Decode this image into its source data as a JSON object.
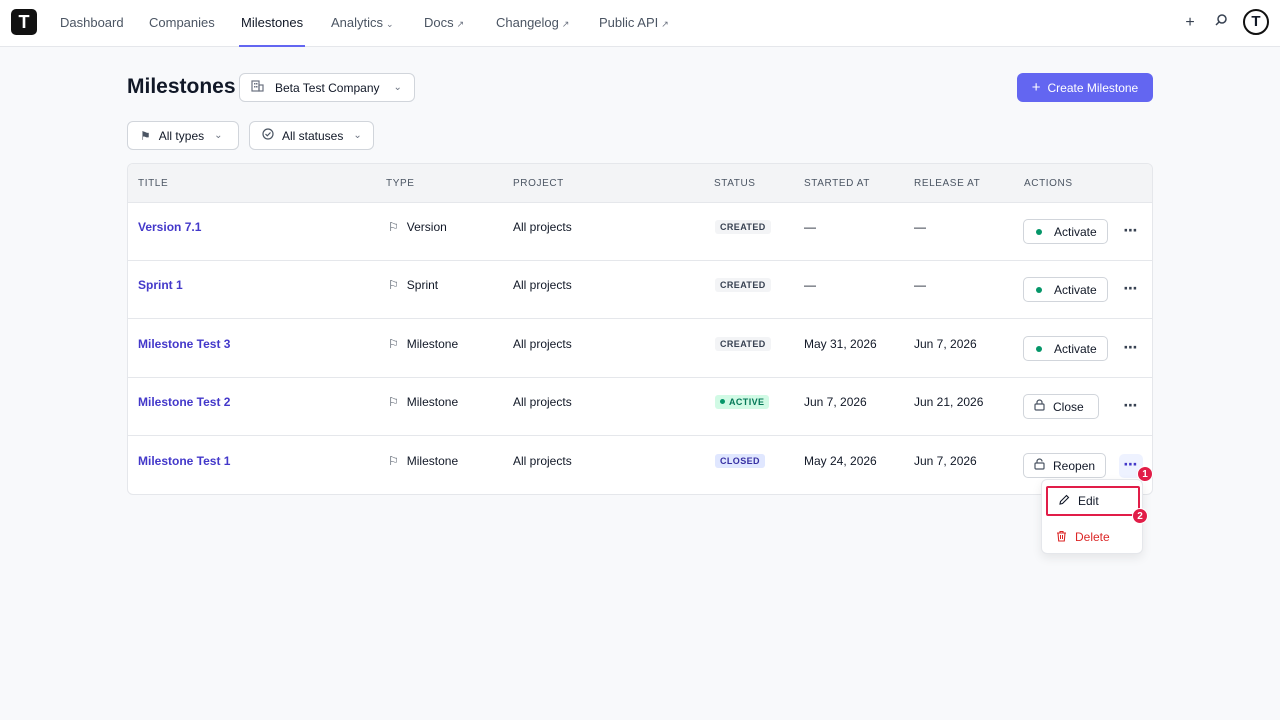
{
  "nav": {
    "logo_letter": "T",
    "items": [
      {
        "label": "Dashboard"
      },
      {
        "label": "Companies"
      },
      {
        "label": "Milestones"
      },
      {
        "label": "Analytics"
      },
      {
        "label": "Docs"
      },
      {
        "label": "Changelog"
      },
      {
        "label": "Public API"
      }
    ],
    "active": "Milestones",
    "avatar_letter": "T"
  },
  "header": {
    "title": "Milestones",
    "company": "Beta Test Company",
    "create_label": "Create Milestone"
  },
  "filters": {
    "types": "All types",
    "statuses": "All statuses"
  },
  "table": {
    "columns": [
      "Title",
      "Type",
      "Project",
      "Status",
      "Started at",
      "Release at",
      "Actions"
    ],
    "rows": [
      {
        "title": "Version 7.1",
        "type": "Version",
        "project": "All projects",
        "status": "CREATED",
        "started": "—",
        "release": "—",
        "action": "Activate"
      },
      {
        "title": "Sprint 1",
        "type": "Sprint",
        "project": "All projects",
        "status": "CREATED",
        "started": "—",
        "release": "—",
        "action": "Activate"
      },
      {
        "title": "Milestone Test 3",
        "type": "Milestone",
        "project": "All projects",
        "status": "CREATED",
        "started": "May 31, 2026",
        "release": "Jun 7, 2026",
        "action": "Activate"
      },
      {
        "title": "Milestone Test 2",
        "type": "Milestone",
        "project": "All projects",
        "status": "ACTIVE",
        "started": "Jun 7, 2026",
        "release": "Jun 21, 2026",
        "action": "Close"
      },
      {
        "title": "Milestone Test 1",
        "type": "Milestone",
        "project": "All projects",
        "status": "CLOSED",
        "started": "May 24, 2026",
        "release": "Jun 7, 2026",
        "action": "Reopen"
      }
    ]
  },
  "menu": {
    "edit": "Edit",
    "delete": "Delete"
  },
  "markers": [
    "1",
    "2"
  ],
  "colors": {
    "accent": "#6366f1",
    "link": "#4338ca",
    "danger": "#dc2626",
    "marker": "#e11d48"
  }
}
